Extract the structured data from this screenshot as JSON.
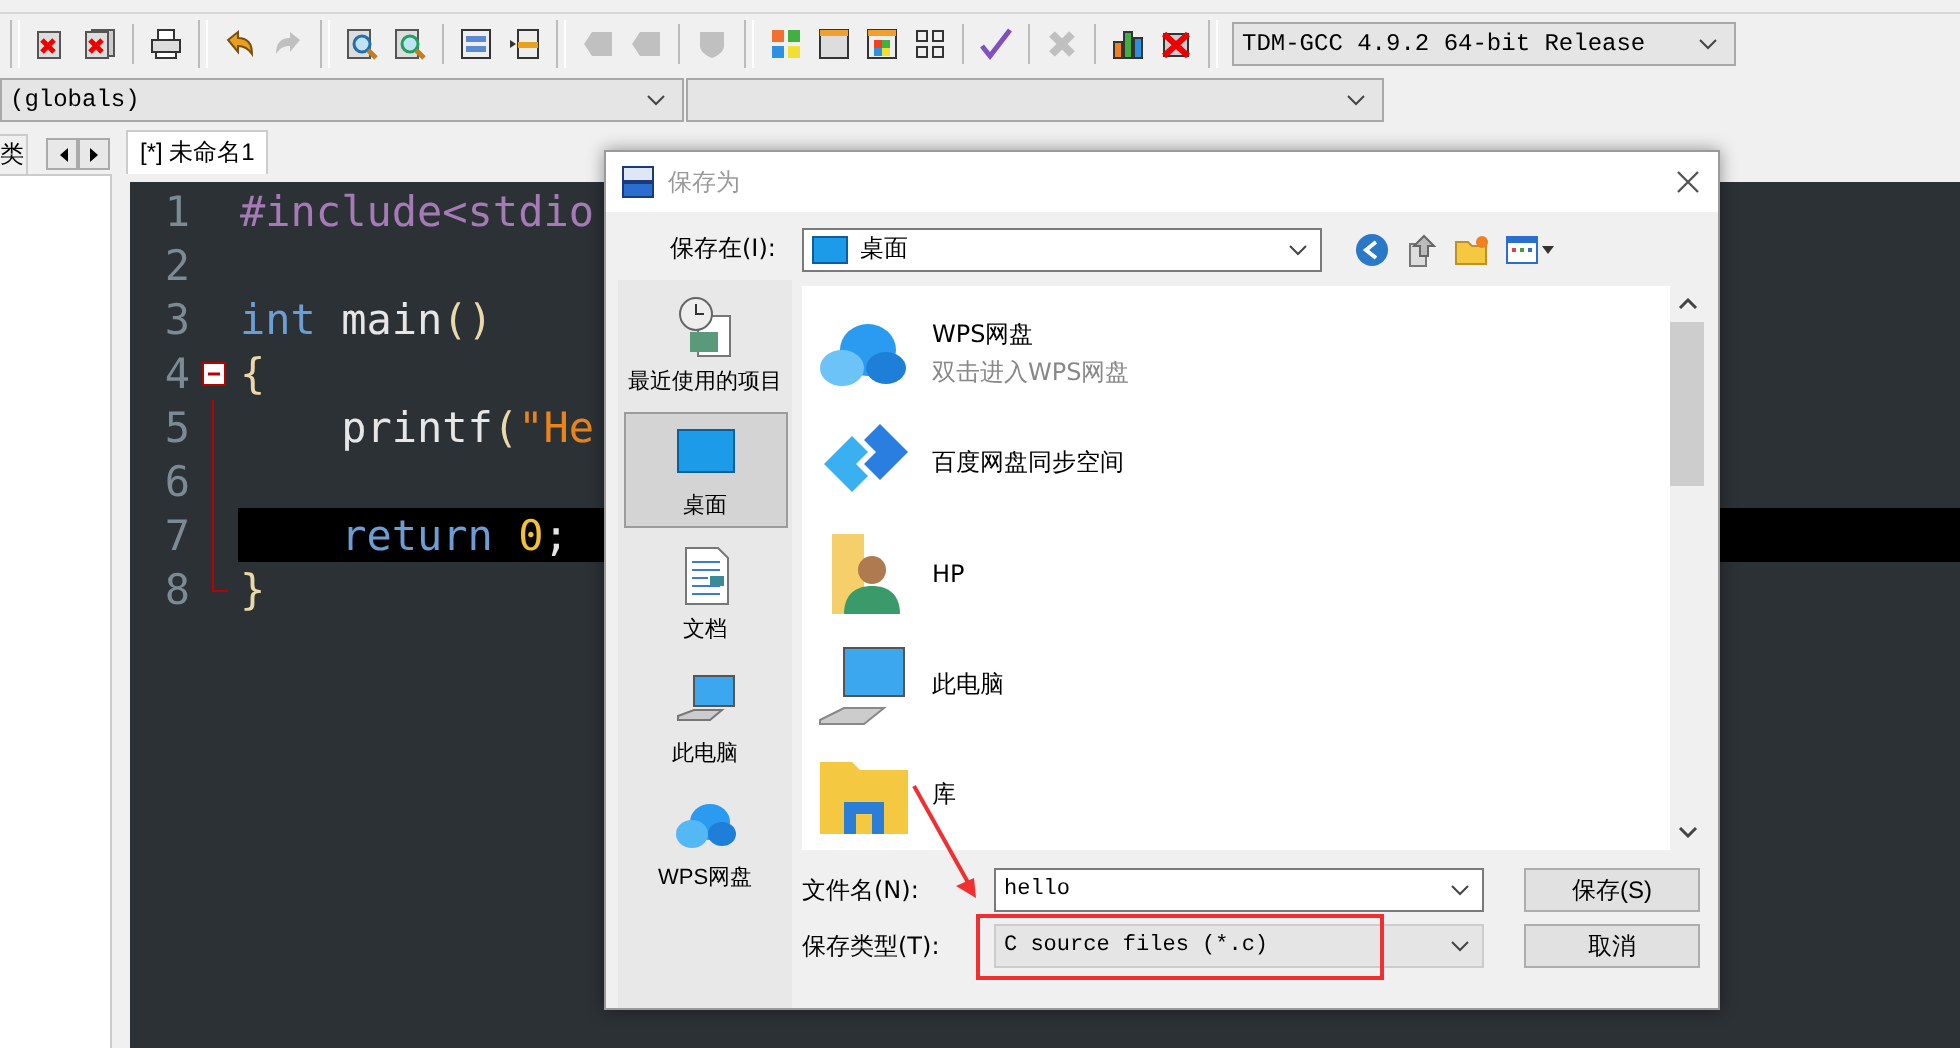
{
  "toolbar": {
    "groups": [
      {
        "items": [
          {
            "kind": "close-file",
            "disabled": false
          },
          {
            "kind": "close-all",
            "disabled": false
          },
          {
            "kind": "separator"
          },
          {
            "kind": "print",
            "disabled": false
          }
        ]
      },
      {
        "items": [
          {
            "kind": "undo",
            "disabled": false
          },
          {
            "kind": "redo",
            "disabled": true
          }
        ]
      },
      {
        "items": [
          {
            "kind": "find",
            "disabled": false
          },
          {
            "kind": "find-next",
            "disabled": false
          },
          {
            "kind": "separator"
          },
          {
            "kind": "panel",
            "disabled": false
          },
          {
            "kind": "toggle",
            "disabled": false
          }
        ]
      },
      {
        "items": [
          {
            "kind": "back",
            "disabled": true
          },
          {
            "kind": "forward",
            "disabled": true
          },
          {
            "kind": "separator"
          },
          {
            "kind": "shield",
            "disabled": true
          }
        ]
      },
      {
        "items": [
          {
            "kind": "tiles",
            "disabled": false
          },
          {
            "kind": "window",
            "disabled": false
          },
          {
            "kind": "color-window",
            "disabled": false
          },
          {
            "kind": "grid",
            "disabled": false
          },
          {
            "kind": "separator"
          },
          {
            "kind": "check",
            "disabled": false
          },
          {
            "kind": "separator"
          },
          {
            "kind": "cross",
            "disabled": true
          },
          {
            "kind": "separator"
          },
          {
            "kind": "chart",
            "disabled": false
          },
          {
            "kind": "stop",
            "disabled": false
          }
        ]
      }
    ],
    "compiler": "TDM-GCC 4.9.2 64-bit Release"
  },
  "scope_bar": {
    "scope": "(globals)"
  },
  "left_panel": {
    "tab": "类"
  },
  "editor": {
    "tab": {
      "label": "[*] 未命名1",
      "selected": true
    },
    "lines": [
      {
        "number": "1",
        "tokens": [
          {
            "kind": "preproc",
            "text": "#include<stdio"
          }
        ],
        "fold": false,
        "current": false
      },
      {
        "number": "2",
        "fold": false,
        "current": false
      },
      {
        "number": "3",
        "tokens": [
          {
            "kind": "keyword",
            "text": "int"
          },
          {
            "kind": "plain",
            "text": " main"
          },
          {
            "kind": "brace",
            "text": "()"
          }
        ],
        "fold": false,
        "current": false
      },
      {
        "number": "4",
        "tokens": [
          {
            "kind": "brace",
            "text": "{"
          }
        ],
        "fold": true,
        "current": false
      },
      {
        "number": "5",
        "tokens": [
          {
            "kind": "plain",
            "text": "    printf"
          },
          {
            "kind": "brace",
            "text": "("
          },
          {
            "kind": "string",
            "text": "\"He"
          }
        ],
        "fold": false,
        "current": false
      },
      {
        "number": "6",
        "fold": false,
        "current": false
      },
      {
        "number": "7",
        "tokens": [
          {
            "kind": "keyword",
            "text": "    return"
          },
          {
            "kind": "number",
            "text": " 0"
          },
          {
            "kind": "plain",
            "text": ";"
          }
        ],
        "fold": false,
        "current": true
      },
      {
        "number": "8",
        "tokens": [
          {
            "kind": "brace",
            "text": "}"
          }
        ],
        "fold": false,
        "current": false
      }
    ]
  },
  "dialog": {
    "title": "保存为",
    "look_in": {
      "label": "保存在(I):",
      "value": "桌面"
    },
    "places": [
      {
        "label": "最近使用的项目",
        "kind": "recent",
        "selected": false
      },
      {
        "label": "桌面",
        "kind": "desktop",
        "selected": true
      },
      {
        "label": "文档",
        "kind": "documents",
        "selected": false
      },
      {
        "label": "此电脑",
        "kind": "computer",
        "selected": false
      },
      {
        "label": "WPS网盘",
        "kind": "cloud",
        "selected": false
      }
    ],
    "files": [
      {
        "name": "WPS网盘",
        "subtitle": "双击进入WPS网盘",
        "kind": "cloud"
      },
      {
        "name": "百度网盘同步空间",
        "kind": "sync"
      },
      {
        "name": "HP",
        "kind": "user-folder"
      },
      {
        "name": "此电脑",
        "kind": "computer"
      },
      {
        "name": "库",
        "kind": "library"
      }
    ],
    "file_name": {
      "label": "文件名(N):",
      "value": "hello"
    },
    "file_type": {
      "label": "保存类型(T):",
      "value": "C source files (*.c)"
    },
    "buttons": [
      {
        "label": "保存(S)"
      },
      {
        "label": "取消"
      }
    ]
  }
}
